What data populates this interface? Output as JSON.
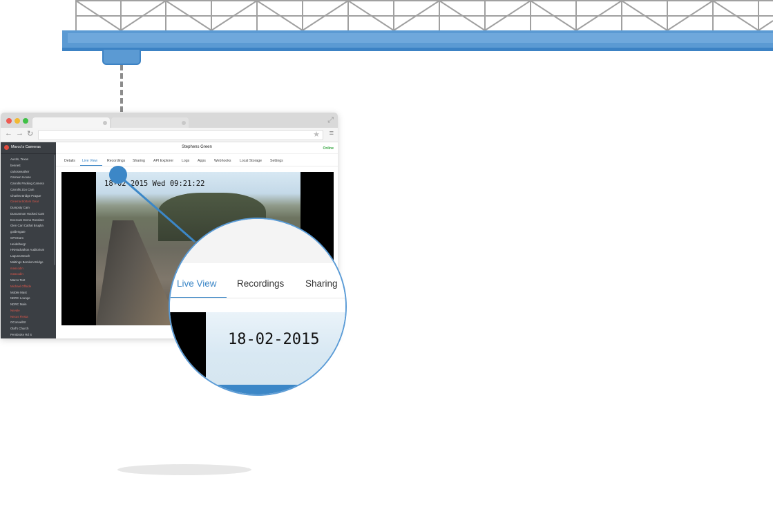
{
  "browser": {
    "camera_title": "Stephens Green",
    "status": "Online",
    "tabs": [
      "Details",
      "Live View",
      "Recordings",
      "Sharing",
      "API Explorer",
      "Logs",
      "Apps",
      "Webhooks",
      "Local Storage",
      "Settings"
    ],
    "active_tab": "Live View",
    "video_timestamp": "18-02-2015 Wed 09:21:22"
  },
  "sidebar": {
    "title": "Marco's Cameras",
    "items": [
      {
        "label": "Austin, Texas",
        "status": "ok"
      },
      {
        "label": "bennett",
        "status": "ok"
      },
      {
        "label": "carlosweather",
        "status": "ok"
      },
      {
        "label": "Carraun House",
        "status": "ok"
      },
      {
        "label": "Carrolls Packing Camera",
        "status": "ok"
      },
      {
        "label": "Carrolls Zoo Cam",
        "status": "ok"
      },
      {
        "label": "Charles Bridge Prague",
        "status": "ok"
      },
      {
        "label": "Cinema Bottom Gear",
        "status": "offline"
      },
      {
        "label": "Dumpsty Cam",
        "status": "ok"
      },
      {
        "label": "Duncannon Hooked Cam",
        "status": "ok"
      },
      {
        "label": "Evercam Demo Rosslare",
        "status": "ok"
      },
      {
        "label": "Glen Cari Cathal Brugha",
        "status": "ok"
      },
      {
        "label": "goldengate",
        "status": "ok"
      },
      {
        "label": "GPOCam",
        "status": "ok"
      },
      {
        "label": "Heidelberg!",
        "status": "ok"
      },
      {
        "label": "HNHackathon Auditorium",
        "status": "ok"
      },
      {
        "label": "Laguna Beach",
        "status": "ok"
      },
      {
        "label": "Maltings Bomlem Bridge",
        "status": "ok"
      },
      {
        "label": "mascodin",
        "status": "offline"
      },
      {
        "label": "mascodin",
        "status": "offline"
      },
      {
        "label": "Marco Test",
        "status": "ok"
      },
      {
        "label": "Michael Offside",
        "status": "offline"
      },
      {
        "label": "Mobile Mast",
        "status": "ok"
      },
      {
        "label": "NDRC Lounge",
        "status": "ok"
      },
      {
        "label": "NDRC Main",
        "status": "ok"
      },
      {
        "label": "Nevale",
        "status": "offline"
      },
      {
        "label": "Nexus Fiesta",
        "status": "offline"
      },
      {
        "label": "OConnellSt",
        "status": "ok"
      },
      {
        "label": "Olaf's Church",
        "status": "ok"
      },
      {
        "label": "Pembroke Rd S",
        "status": "ok"
      }
    ]
  },
  "magnifier": {
    "tabs": [
      "Live View",
      "Recordings",
      "Sharing"
    ],
    "active_tab": "Live View",
    "timestamp": "18-02-2015"
  },
  "colors": {
    "accent": "#3c87c7",
    "beam": "#5b9ad3",
    "online": "#3aa745",
    "offline": "#e0574a",
    "sidebar_bg": "#3b3f44"
  },
  "icons": [
    "close-dot-icon",
    "minimize-dot-icon",
    "maximize-dot-icon",
    "expand-icon",
    "back-arrow-icon",
    "forward-arrow-icon",
    "reload-icon",
    "star-icon",
    "menu-icon",
    "camera-logo-icon"
  ]
}
